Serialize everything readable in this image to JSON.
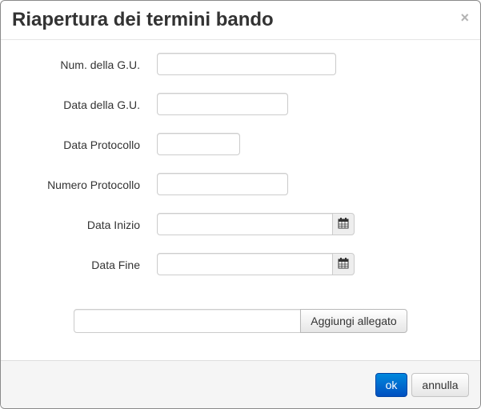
{
  "dialog": {
    "title": "Riapertura dei termini bando",
    "close_label": "×"
  },
  "form": {
    "num_gu": {
      "label": "Num. della G.U.",
      "value": ""
    },
    "data_gu": {
      "label": "Data della G.U.",
      "value": ""
    },
    "data_protocollo": {
      "label": "Data Protocollo",
      "value": ""
    },
    "numero_protocollo": {
      "label": "Numero Protocollo",
      "value": ""
    },
    "data_inizio": {
      "label": "Data Inizio",
      "value": "",
      "icon": "calendar-icon"
    },
    "data_fine": {
      "label": "Data Fine",
      "value": "",
      "icon": "calendar-icon"
    }
  },
  "attachment": {
    "value": "",
    "button_label": "Aggiungi allegato"
  },
  "footer": {
    "ok_label": "ok",
    "cancel_label": "annulla"
  },
  "colors": {
    "primary": "#0066cc",
    "title": "#333333",
    "footer_bg": "#f5f5f5"
  }
}
